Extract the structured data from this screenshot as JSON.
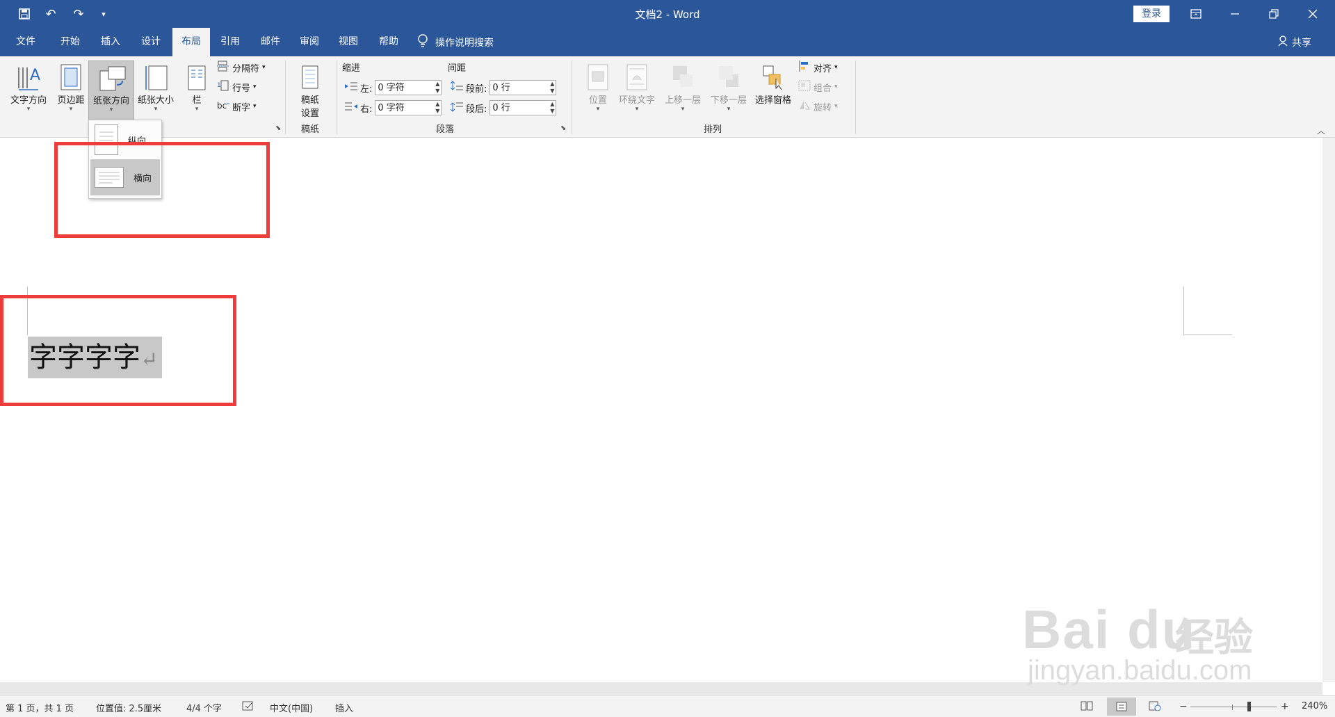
{
  "titlebar": {
    "doc_title": "文档2  -  Word",
    "signin": "登录",
    "icons": [
      "save-icon",
      "undo-icon",
      "redo-icon",
      "customize-icon"
    ],
    "window_buttons": [
      "ribbon-display-icon",
      "minimize-icon",
      "restore-icon",
      "close-icon"
    ],
    "accent": "#2b579a"
  },
  "tabs": [
    "文件",
    "开始",
    "插入",
    "设计",
    "布局",
    "引用",
    "邮件",
    "审阅",
    "视图",
    "帮助"
  ],
  "active_tab": "布局",
  "tellme": "操作说明搜索",
  "share": "共享",
  "ribbon": {
    "page_setup": {
      "text_direction": "文字方向",
      "margins": "页边距",
      "orientation": "纸张方向",
      "size": "纸张大小",
      "columns": "栏",
      "breaks": "分隔符",
      "line_numbers": "行号",
      "hyphenation": "断字"
    },
    "manuscript": {
      "button1": "稿纸",
      "button2": "设置",
      "label": "稿纸"
    },
    "paragraph": {
      "indent_title": "缩进",
      "spacing_title": "间距",
      "left_label": "左:",
      "right_label": "右:",
      "left_value": "0 字符",
      "right_value": "0 字符",
      "before_label": "段前:",
      "after_label": "段后:",
      "before_value": "0 行",
      "after_value": "0 行",
      "label": "段落"
    },
    "arrange": {
      "position": "位置",
      "wrap_text": "环绕文字",
      "bring_forward": "上移一层",
      "send_backward": "下移一层",
      "selection_pane": "选择窗格",
      "align": "对齐",
      "group": "组合",
      "rotate": "旋转",
      "label": "排列"
    }
  },
  "orientation_menu": {
    "portrait": "纵向",
    "landscape": "横向"
  },
  "document": {
    "text": "字字字字",
    "pilcrow": "↵"
  },
  "watermark": {
    "brand": "Bai du",
    "cn": "经验",
    "url": "jingyan.baidu.com"
  },
  "statusbar": {
    "page": "第 1 页，共 1 页",
    "position": "位置值: 2.5厘米",
    "words": "4/4 个字",
    "language": "中文(中国)",
    "mode": "插入",
    "zoom": "240%"
  }
}
